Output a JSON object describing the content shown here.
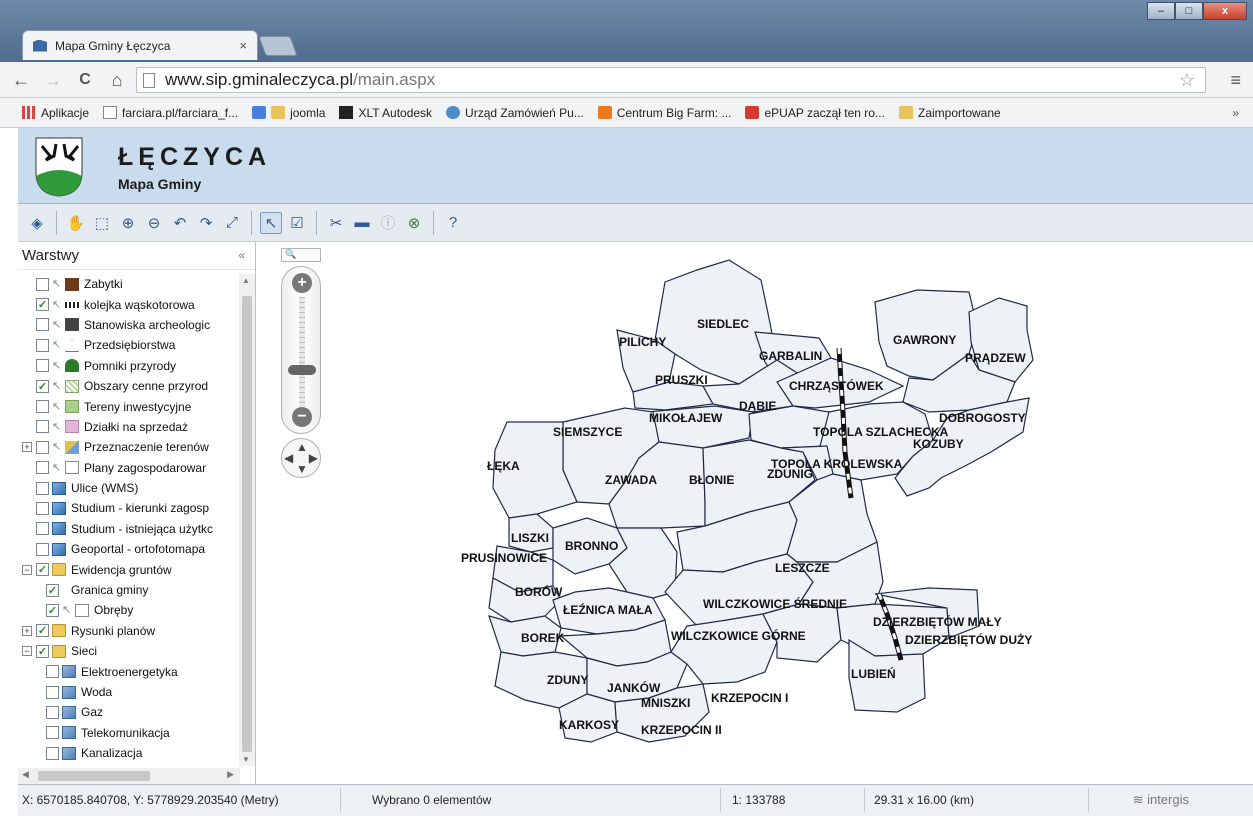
{
  "browser": {
    "tab_title": "Mapa Gminy Łęczyca",
    "tab_close": "×",
    "url_host": "www.sip.gminaleczyca.pl",
    "url_path": "/main.aspx",
    "bookmarks": [
      "Aplikacje",
      "farciara.pl/farciara_f...",
      "joomla",
      "XLT Autodesk",
      "Urząd Zamówień Pu...",
      "Centrum Big Farm: ...",
      "ePUAP zaczął ten ro...",
      "Zaimportowane"
    ],
    "bookmarks_more": "»",
    "nav": {
      "back": "←",
      "forward": "→",
      "reload": "C",
      "home": "⌂"
    },
    "star": "☆",
    "menu": "≡"
  },
  "app": {
    "title": "ŁĘCZYCA",
    "subtitle": "Mapa Gminy"
  },
  "layers_panel": {
    "title": "Warstwy",
    "collapse": "«",
    "layers": [
      {
        "label": "Zabytki",
        "checked": false,
        "indent": 0,
        "expander": "",
        "arrow": true,
        "symbol": "sym-brown"
      },
      {
        "label": "kolejka wąskotorowa",
        "checked": true,
        "indent": 0,
        "expander": "",
        "arrow": true,
        "symbol": "sym-rail"
      },
      {
        "label": "Stanowiska archeologic",
        "checked": false,
        "indent": 0,
        "expander": "",
        "arrow": true,
        "symbol": "sym-arch"
      },
      {
        "label": "Przedsiębiorstwa",
        "checked": false,
        "indent": 0,
        "expander": "",
        "arrow": true,
        "symbol": "sym-tri"
      },
      {
        "label": "Pomniki przyrody",
        "checked": false,
        "indent": 0,
        "expander": "",
        "arrow": true,
        "symbol": "sym-tree"
      },
      {
        "label": "Obszary cenne przyrod",
        "checked": true,
        "indent": 0,
        "expander": "",
        "arrow": true,
        "symbol": "sym-hatch"
      },
      {
        "label": "Tereny inwestycyjne",
        "checked": false,
        "indent": 0,
        "expander": "",
        "arrow": true,
        "symbol": "sym-green"
      },
      {
        "label": "Działki na sprzedaż",
        "checked": false,
        "indent": 0,
        "expander": "",
        "arrow": true,
        "symbol": "sym-pink"
      },
      {
        "label": "Przeznaczenie terenów",
        "checked": false,
        "indent": 0,
        "expander": "+",
        "arrow": true,
        "symbol": "sym-multi"
      },
      {
        "label": "Plany zagospodarowar",
        "checked": false,
        "indent": 0,
        "expander": "",
        "arrow": true,
        "symbol": "sym-empty"
      },
      {
        "label": "Ulice (WMS)",
        "checked": false,
        "indent": 0,
        "expander": "",
        "arrow": false,
        "symbol": "sym-wms"
      },
      {
        "label": "Studium - kierunki zagosp",
        "checked": false,
        "indent": 0,
        "expander": "",
        "arrow": false,
        "symbol": "sym-wms"
      },
      {
        "label": "Studium - istniejąca użytkc",
        "checked": false,
        "indent": 0,
        "expander": "",
        "arrow": false,
        "symbol": "sym-wms"
      },
      {
        "label": "Geoportal - ortofotomapa",
        "checked": false,
        "indent": 0,
        "expander": "",
        "arrow": false,
        "symbol": "sym-wms"
      },
      {
        "label": "Ewidencja gruntów",
        "checked": true,
        "indent": 0,
        "expander": "−",
        "arrow": false,
        "symbol": "sym-folder"
      },
      {
        "label": "Granica gminy",
        "checked": true,
        "indent": 1,
        "expander": "",
        "arrow": false,
        "symbol": ""
      },
      {
        "label": "Obręby",
        "checked": true,
        "indent": 1,
        "expander": "",
        "arrow": true,
        "symbol": "sym-empty"
      },
      {
        "label": "Rysunki planów",
        "checked": true,
        "indent": 0,
        "expander": "+",
        "arrow": false,
        "symbol": "sym-folder"
      },
      {
        "label": "Sieci",
        "checked": true,
        "indent": 0,
        "expander": "−",
        "arrow": false,
        "symbol": "sym-folder"
      },
      {
        "label": "Elektroenergetyka",
        "checked": false,
        "indent": 1,
        "expander": "",
        "arrow": false,
        "symbol": "sym-net"
      },
      {
        "label": "Woda",
        "checked": false,
        "indent": 1,
        "expander": "",
        "arrow": false,
        "symbol": "sym-net"
      },
      {
        "label": "Gaz",
        "checked": false,
        "indent": 1,
        "expander": "",
        "arrow": false,
        "symbol": "sym-net"
      },
      {
        "label": "Telekomunikacja",
        "checked": false,
        "indent": 1,
        "expander": "",
        "arrow": false,
        "symbol": "sym-net"
      },
      {
        "label": "Kanalizacja",
        "checked": false,
        "indent": 1,
        "expander": "",
        "arrow": false,
        "symbol": "sym-net"
      }
    ]
  },
  "map": {
    "search_glyph": "🔍",
    "zoom_in": "+",
    "zoom_out": "−",
    "labels": [
      "SIEDLEC",
      "PILICHY",
      "GARBALIN",
      "GAWRONY",
      "PRĄDZEW",
      "PRUSZKI",
      "CHRZĄSTÓWEK",
      "DĄBIE",
      "MIKOŁAJEW",
      "DOBROGOSTY",
      "SIEMSZYCE",
      "TOPOLA SZLACHECKA",
      "KOZUBY",
      "TOPOLA KRÓLEWSKA",
      "ZDUNIG",
      "ŁĘKA",
      "ZAWADA",
      "BŁONIE",
      "LISZKI",
      "BRONNO",
      "PRUSINOWICE",
      "LESZCZE",
      "BORÓW",
      "WILCZKOWICE ŚREDNIE",
      "ŁEŹNICA MAŁA",
      "DZIERZBIĘTÓW MAŁY",
      "DZIERZBIĘTÓW DUŻY",
      "BOREK",
      "WILCZKOWICE GÓRNE",
      "LUBIEŃ",
      "ZDUNY",
      "JANKÓW",
      "MNISZKI",
      "KRZEPOCIN I",
      "KARKOSY",
      "KRZEPOCIN II"
    ]
  },
  "status": {
    "coords": "X: 6570185.840708, Y: 5778929.203540 (Metry)",
    "selection": "Wybrano 0 elementów",
    "scale": "1: 133788",
    "extent": "29.31 x 16.00 (km)",
    "brand": "intergis"
  },
  "colors": {
    "header_bg": "#c8dcee",
    "map_fill": "#eef1f6",
    "boundary": "#1f2b4a"
  }
}
